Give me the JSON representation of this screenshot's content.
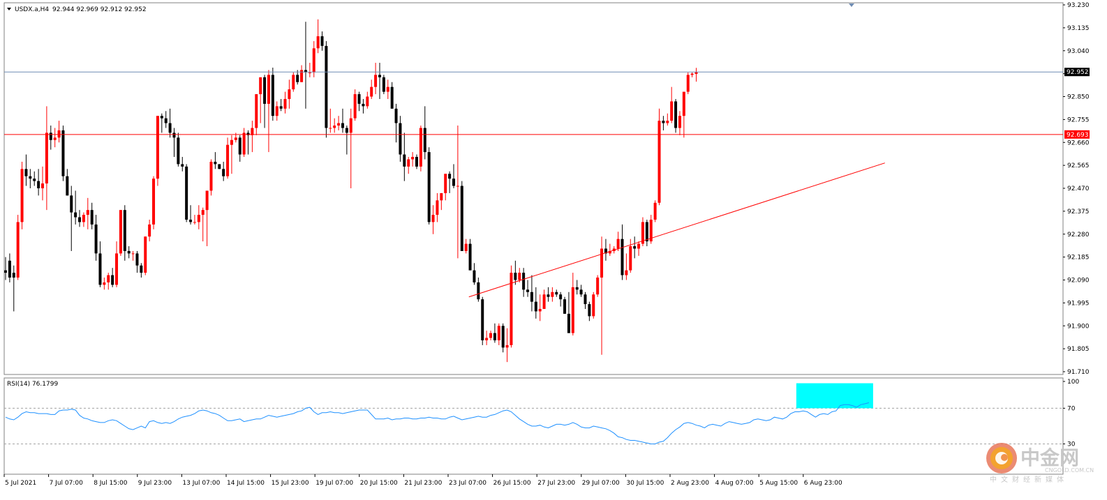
{
  "colors": {
    "background": "#ffffff",
    "bull": "#ff0000",
    "bear": "#000000",
    "bid_line": "#6e8cb4",
    "level_line": "#ff0000",
    "rsi_line": "#1e90ff",
    "rsi_highlight": "#00ffff",
    "grid": "#c0c0c0"
  },
  "header": {
    "symbol": "USDX.a,H4",
    "ohlc": "92.944 92.969 92.912 92.952"
  },
  "rsi_header": "RSI(14) 76.1799",
  "watermark": {
    "name": "中金网",
    "domain": "CNGOLD.COM.CN",
    "tagline": "中文财经新媒体",
    "logo_icon": "cngold-logo-icon"
  },
  "chart_data": [
    {
      "type": "candlestick",
      "instrument": "USDX.a",
      "timeframe": "H4",
      "ohlc_readout": {
        "open": 92.944,
        "high": 92.969,
        "low": 92.912,
        "close": 92.952
      },
      "y_range": [
        91.71,
        93.23
      ],
      "y_ticks": [
        "93.230",
        "93.135",
        "93.040",
        "92.945",
        "92.850",
        "92.755",
        "92.660",
        "92.565",
        "92.470",
        "92.375",
        "92.280",
        "92.185",
        "92.090",
        "91.995",
        "91.900",
        "91.805",
        "91.710"
      ],
      "x_ticks": [
        "5 Jul 2021",
        "7 Jul 07:00",
        "8 Jul 15:00",
        "9 Jul 23:00",
        "13 Jul 07:00",
        "14 Jul 15:00",
        "15 Jul 23:00",
        "19 Jul 07:00",
        "20 Jul 15:00",
        "21 Jul 23:00",
        "23 Jul 07:00",
        "26 Jul 15:00",
        "27 Jul 23:00",
        "29 Jul 07:00",
        "30 Jul 15:00",
        "2 Aug 23:00",
        "4 Aug 07:00",
        "5 Aug 15:00",
        "6 Aug 23:00"
      ],
      "price_labels": [
        {
          "label": "92.952",
          "value": 92.952,
          "kind": "bid"
        },
        {
          "label": "92.693",
          "value": 92.693,
          "kind": "horizontal-level"
        }
      ],
      "trendline": {
        "from": {
          "bar": 111,
          "price": 92.02
        },
        "to": {
          "bar": 202,
          "price": 92.575
        }
      },
      "candles": [
        [
          92.13,
          92.185,
          92.09,
          92.12
        ],
        [
          92.17,
          92.2,
          92.08,
          92.1
        ],
        [
          92.12,
          92.15,
          91.96,
          92.1
        ],
        [
          92.1,
          92.36,
          92.09,
          92.33
        ],
        [
          92.33,
          92.58,
          92.3,
          92.55
        ],
        [
          92.55,
          92.61,
          92.48,
          92.52
        ],
        [
          92.52,
          92.55,
          92.47,
          92.51
        ],
        [
          92.51,
          92.54,
          92.48,
          92.5
        ],
        [
          92.5,
          92.55,
          92.44,
          92.47
        ],
        [
          92.47,
          92.56,
          92.42,
          92.49
        ],
        [
          92.49,
          92.81,
          92.38,
          92.7
        ],
        [
          92.7,
          92.73,
          92.63,
          92.67
        ],
        [
          92.67,
          92.72,
          92.64,
          92.68
        ],
        [
          92.68,
          92.75,
          92.66,
          92.71
        ],
        [
          92.71,
          92.73,
          92.5,
          92.52
        ],
        [
          92.52,
          92.55,
          92.44,
          92.44
        ],
        [
          92.44,
          92.48,
          92.21,
          92.37
        ],
        [
          92.37,
          92.46,
          92.32,
          92.35
        ],
        [
          92.35,
          92.38,
          92.31,
          92.33
        ],
        [
          92.33,
          92.37,
          92.31,
          92.36
        ],
        [
          92.36,
          92.43,
          92.3,
          92.38
        ],
        [
          92.38,
          92.41,
          92.3,
          92.32
        ],
        [
          92.32,
          92.36,
          92.17,
          92.2
        ],
        [
          92.2,
          92.25,
          92.06,
          92.07
        ],
        [
          92.07,
          92.1,
          92.05,
          92.08
        ],
        [
          92.08,
          92.12,
          92.05,
          92.11
        ],
        [
          92.11,
          92.14,
          92.06,
          92.07
        ],
        [
          92.07,
          92.25,
          92.06,
          92.2
        ],
        [
          92.2,
          92.38,
          92.19,
          92.38
        ],
        [
          92.38,
          92.4,
          92.17,
          92.21
        ],
        [
          92.21,
          92.23,
          92.18,
          92.2
        ],
        [
          92.2,
          92.21,
          92.17,
          92.2
        ],
        [
          92.2,
          92.21,
          92.12,
          92.15
        ],
        [
          92.15,
          92.16,
          92.1,
          92.12
        ],
        [
          92.12,
          92.27,
          92.11,
          92.27
        ],
        [
          92.27,
          92.34,
          92.25,
          92.32
        ],
        [
          92.32,
          92.52,
          92.3,
          92.51
        ],
        [
          92.51,
          92.77,
          92.48,
          92.77
        ],
        [
          92.77,
          92.78,
          92.7,
          92.76
        ],
        [
          92.76,
          92.79,
          92.72,
          92.74
        ],
        [
          92.74,
          92.8,
          92.68,
          92.7
        ],
        [
          92.7,
          92.72,
          92.6,
          92.68
        ],
        [
          92.68,
          92.7,
          92.56,
          92.57
        ],
        [
          92.57,
          92.6,
          92.54,
          92.56
        ],
        [
          92.56,
          92.57,
          92.33,
          92.34
        ],
        [
          92.34,
          92.4,
          92.32,
          92.33
        ],
        [
          92.33,
          92.36,
          92.32,
          92.33
        ],
        [
          92.33,
          92.4,
          92.3,
          92.36
        ],
        [
          92.36,
          92.39,
          92.25,
          92.38
        ],
        [
          92.38,
          92.46,
          92.23,
          92.46
        ],
        [
          92.46,
          92.59,
          92.44,
          92.58
        ],
        [
          92.58,
          92.62,
          92.55,
          92.57
        ],
        [
          92.57,
          92.57,
          92.55,
          92.55
        ],
        [
          92.55,
          92.58,
          92.5,
          92.52
        ],
        [
          92.52,
          92.68,
          92.51,
          92.65
        ],
        [
          92.65,
          92.69,
          92.53,
          92.67
        ],
        [
          92.67,
          92.7,
          92.66,
          92.68
        ],
        [
          92.68,
          92.69,
          92.58,
          92.61
        ],
        [
          92.61,
          92.72,
          92.6,
          92.7
        ],
        [
          92.7,
          92.71,
          92.61,
          92.69
        ],
        [
          92.69,
          92.75,
          92.62,
          92.72
        ],
        [
          92.72,
          92.86,
          92.69,
          92.86
        ],
        [
          92.86,
          92.93,
          92.74,
          92.93
        ],
        [
          92.93,
          92.94,
          92.72,
          92.82
        ],
        [
          92.82,
          92.96,
          92.62,
          92.94
        ],
        [
          92.94,
          92.97,
          92.75,
          92.77
        ],
        [
          92.77,
          92.83,
          92.75,
          92.81
        ],
        [
          92.81,
          92.84,
          92.79,
          92.8
        ],
        [
          92.8,
          92.87,
          92.78,
          92.84
        ],
        [
          92.84,
          92.92,
          92.8,
          92.88
        ],
        [
          92.88,
          92.95,
          92.87,
          92.94
        ],
        [
          92.94,
          92.96,
          92.9,
          92.91
        ],
        [
          92.91,
          92.98,
          92.91,
          92.96
        ],
        [
          92.96,
          93.16,
          92.8,
          92.95
        ],
        [
          92.95,
          92.99,
          92.93,
          92.95
        ],
        [
          92.95,
          93.08,
          92.93,
          93.05
        ],
        [
          93.05,
          93.17,
          93.03,
          93.1
        ],
        [
          93.1,
          93.12,
          93.04,
          93.06
        ],
        [
          93.06,
          93.08,
          92.68,
          92.72
        ],
        [
          92.72,
          92.8,
          92.7,
          92.72
        ],
        [
          92.72,
          92.76,
          92.7,
          92.73
        ],
        [
          92.73,
          92.77,
          92.71,
          92.74
        ],
        [
          92.74,
          92.8,
          92.7,
          92.72
        ],
        [
          92.72,
          92.73,
          92.61,
          92.7
        ],
        [
          92.7,
          92.8,
          92.47,
          92.76
        ],
        [
          92.76,
          92.88,
          92.75,
          92.86
        ],
        [
          92.86,
          92.87,
          92.79,
          92.82
        ],
        [
          92.82,
          92.84,
          92.78,
          92.81
        ],
        [
          92.81,
          92.87,
          92.8,
          92.85
        ],
        [
          92.85,
          92.92,
          92.84,
          92.89
        ],
        [
          92.89,
          92.99,
          92.86,
          92.94
        ],
        [
          92.94,
          92.99,
          92.84,
          92.93
        ],
        [
          92.93,
          92.94,
          92.86,
          92.87
        ],
        [
          92.87,
          92.92,
          92.84,
          92.89
        ],
        [
          92.89,
          92.91,
          92.8,
          92.8
        ],
        [
          92.8,
          92.82,
          92.66,
          92.74
        ],
        [
          92.74,
          92.77,
          92.58,
          92.61
        ],
        [
          92.61,
          92.7,
          92.5,
          92.56
        ],
        [
          92.56,
          92.6,
          92.53,
          92.59
        ],
        [
          92.59,
          92.62,
          92.56,
          92.6
        ],
        [
          92.6,
          92.61,
          92.55,
          92.56
        ],
        [
          92.56,
          92.73,
          92.54,
          92.72
        ],
        [
          92.72,
          92.81,
          92.59,
          92.62
        ],
        [
          92.62,
          92.64,
          92.32,
          92.33
        ],
        [
          92.33,
          92.4,
          92.28,
          92.36
        ],
        [
          92.36,
          92.45,
          92.33,
          92.42
        ],
        [
          92.42,
          92.45,
          92.38,
          92.45
        ],
        [
          92.45,
          92.53,
          92.42,
          92.53
        ],
        [
          92.53,
          92.54,
          92.45,
          92.51
        ],
        [
          92.51,
          92.57,
          92.47,
          92.48
        ],
        [
          92.48,
          92.73,
          92.18,
          92.48
        ],
        [
          92.48,
          92.5,
          92.21,
          92.21
        ],
        [
          92.21,
          92.26,
          92.2,
          92.24
        ],
        [
          92.24,
          92.26,
          92.19,
          92.13
        ],
        [
          92.13,
          92.16,
          92.07,
          92.08
        ],
        [
          92.08,
          92.1,
          92.0,
          92.01
        ],
        [
          92.01,
          92.02,
          91.82,
          91.84
        ],
        [
          91.84,
          91.88,
          91.82,
          91.85
        ],
        [
          91.85,
          91.88,
          91.84,
          91.87
        ],
        [
          91.87,
          91.91,
          91.83,
          91.84
        ],
        [
          91.84,
          91.91,
          91.82,
          91.9
        ],
        [
          91.9,
          91.91,
          91.79,
          91.81
        ],
        [
          91.81,
          91.89,
          91.75,
          91.82
        ],
        [
          91.82,
          92.15,
          91.81,
          92.12
        ],
        [
          92.12,
          92.17,
          92.07,
          92.09
        ],
        [
          92.09,
          92.14,
          92.08,
          92.12
        ],
        [
          92.12,
          92.14,
          92.02,
          92.05
        ],
        [
          92.05,
          92.09,
          92.02,
          92.04
        ],
        [
          92.04,
          92.11,
          91.96,
          92.0
        ],
        [
          92.0,
          92.06,
          91.93,
          91.96
        ],
        [
          91.96,
          92.03,
          91.92,
          91.97
        ],
        [
          91.97,
          92.05,
          91.97,
          92.03
        ],
        [
          92.03,
          92.06,
          92.0,
          92.02
        ],
        [
          92.02,
          92.06,
          92.0,
          92.04
        ],
        [
          92.04,
          92.05,
          92.02,
          92.03
        ],
        [
          92.03,
          92.04,
          91.98,
          92.01
        ],
        [
          92.01,
          92.02,
          91.95,
          91.95
        ],
        [
          91.95,
          92.04,
          91.9,
          91.87
        ],
        [
          91.87,
          92.12,
          91.86,
          92.06
        ],
        [
          92.06,
          92.09,
          92.03,
          92.05
        ],
        [
          92.05,
          92.07,
          92.02,
          92.03
        ],
        [
          92.03,
          92.04,
          91.97,
          91.99
        ],
        [
          91.99,
          92.0,
          91.92,
          91.94
        ],
        [
          91.94,
          92.04,
          91.93,
          92.03
        ],
        [
          92.03,
          92.11,
          92.02,
          92.1
        ],
        [
          92.1,
          92.27,
          91.78,
          92.22
        ],
        [
          92.22,
          92.26,
          92.17,
          92.2
        ],
        [
          92.2,
          92.24,
          92.19,
          92.21
        ],
        [
          92.21,
          92.23,
          92.2,
          92.22
        ],
        [
          92.22,
          92.29,
          92.21,
          92.26
        ],
        [
          92.26,
          92.32,
          92.09,
          92.11
        ],
        [
          92.11,
          92.2,
          92.09,
          92.13
        ],
        [
          92.13,
          92.26,
          92.12,
          92.23
        ],
        [
          92.23,
          92.27,
          92.18,
          92.22
        ],
        [
          92.22,
          92.25,
          92.19,
          92.24
        ],
        [
          92.24,
          92.35,
          92.23,
          92.33
        ],
        [
          92.33,
          92.34,
          92.23,
          92.25
        ],
        [
          92.25,
          92.36,
          92.24,
          92.34
        ],
        [
          92.34,
          92.42,
          92.33,
          92.41
        ],
        [
          92.41,
          92.8,
          92.4,
          92.75
        ],
        [
          92.75,
          92.77,
          92.71,
          92.74
        ],
        [
          92.74,
          92.78,
          92.73,
          92.75
        ],
        [
          92.75,
          92.89,
          92.74,
          92.83
        ],
        [
          92.83,
          92.84,
          92.7,
          92.72
        ],
        [
          92.72,
          92.79,
          92.69,
          92.77
        ],
        [
          92.77,
          92.85,
          92.68,
          92.87
        ],
        [
          92.87,
          92.95,
          92.86,
          92.94
        ],
        [
          92.94,
          92.95,
          92.93,
          92.945
        ],
        [
          92.944,
          92.969,
          92.912,
          92.952
        ]
      ]
    },
    {
      "type": "line",
      "indicator": "RSI(14)",
      "last_value": 76.1799,
      "y_range": [
        0,
        100
      ],
      "y_ticks": [
        "100",
        "70",
        "30"
      ],
      "levels": [
        70,
        30
      ],
      "values": [
        60,
        58,
        57,
        60,
        64,
        66,
        65,
        65,
        64,
        64,
        64,
        63,
        63,
        67,
        68,
        68,
        69,
        68,
        62,
        59,
        58,
        56,
        55,
        54,
        54,
        56,
        57,
        56,
        53,
        50,
        47,
        46,
        48,
        50,
        48,
        55,
        56,
        54,
        53,
        54,
        53,
        55,
        58,
        60,
        61,
        62,
        64,
        67,
        68,
        67,
        65,
        64,
        62,
        59,
        56,
        56,
        57,
        58,
        55,
        56,
        57,
        58,
        58,
        60,
        62,
        61,
        60,
        61,
        62,
        63,
        64,
        66,
        67,
        70,
        71,
        66,
        63,
        65,
        65,
        66,
        65,
        65,
        64,
        65,
        66,
        67,
        68,
        68,
        68,
        63,
        58,
        58,
        58,
        59,
        57,
        58,
        58,
        59,
        59,
        58,
        58,
        59,
        59,
        60,
        59,
        59,
        58,
        58,
        60,
        61,
        59,
        57,
        58,
        59,
        60,
        61,
        60,
        60,
        62,
        63,
        65,
        67,
        68,
        66,
        62,
        58,
        55,
        52,
        50,
        50,
        51,
        49,
        48,
        50,
        52,
        52,
        51,
        52,
        54,
        52,
        49,
        48,
        48,
        50,
        49,
        48,
        47,
        45,
        42,
        38,
        37,
        35,
        34,
        34,
        33,
        32,
        31,
        30,
        30,
        32,
        33,
        37,
        42,
        46,
        49,
        53,
        54,
        53,
        51,
        50,
        48,
        51,
        52,
        51,
        50,
        53,
        55,
        54,
        53,
        52,
        53,
        54,
        57,
        58,
        57,
        56,
        57,
        60,
        59,
        58,
        60,
        64,
        66,
        66,
        67,
        66,
        63,
        60,
        63,
        64,
        63,
        66,
        67,
        73,
        74,
        74,
        73,
        71,
        74,
        75,
        76.2
      ]
    }
  ]
}
